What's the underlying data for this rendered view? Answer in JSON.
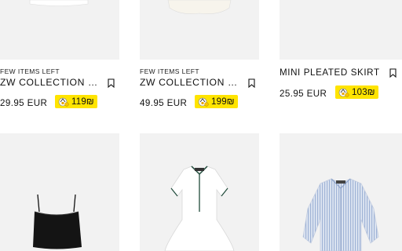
{
  "products": [
    {
      "tag": "FEW ITEMS LEFT",
      "name": "ZW COLLECTION EMBROIDERED...",
      "price": "29.95 EUR",
      "badge_amount": "119₪",
      "bookmark_icon": "bookmark-icon"
    },
    {
      "tag": "FEW ITEMS LEFT",
      "name": "ZW COLLECTION EMBROIDERED...",
      "price": "49.95 EUR",
      "badge_amount": "199₪",
      "bookmark_icon": "bookmark-icon"
    },
    {
      "tag": "",
      "name": "MINI PLEATED SKIRT",
      "price": "25.95 EUR",
      "badge_amount": "103₪",
      "bookmark_icon": "bookmark-icon"
    }
  ],
  "row2_items": [
    "black-crop-top-image",
    "white-polo-dress-image",
    "striped-blue-shirt-image"
  ],
  "colors": {
    "badge": "#ffe400",
    "card_bg": "#f2f2f2",
    "text": "#111111"
  }
}
